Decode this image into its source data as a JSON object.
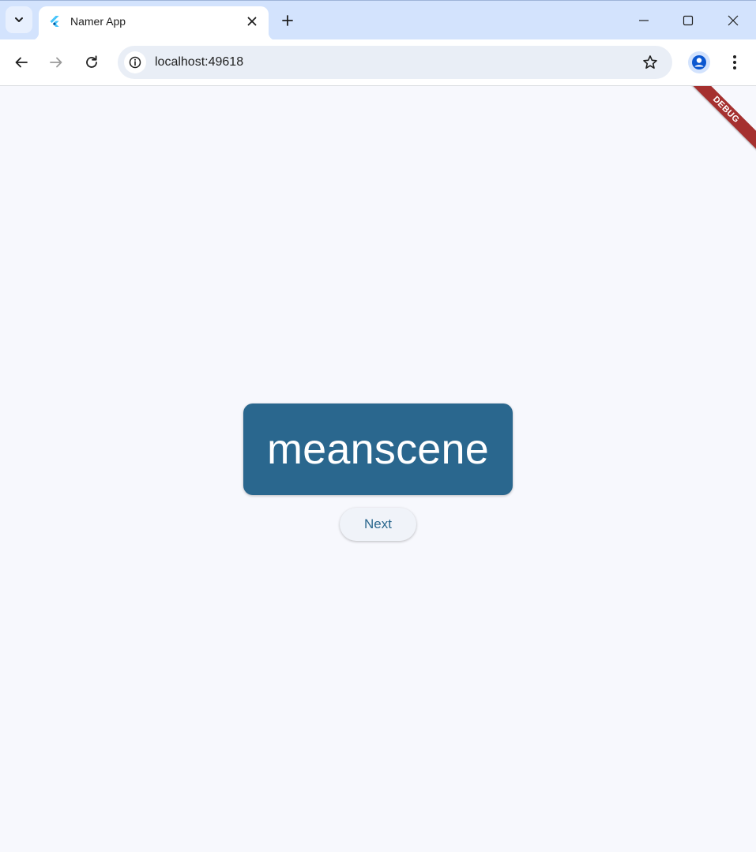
{
  "browser": {
    "tab": {
      "title": "Namer App",
      "favicon_icon": "flutter-icon"
    },
    "address_bar": {
      "url": "localhost:49618"
    },
    "colors": {
      "tabstrip": "#d3e3fd",
      "toolbar": "#ffffff",
      "omnibox": "#e9eef6"
    }
  },
  "app": {
    "word": "meanscene",
    "next_label": "Next",
    "debug_banner": "DEBUG",
    "colors": {
      "background": "#f7f8fd",
      "card": "#2a678e",
      "card_text": "#ffffff",
      "button_text": "#2a678e",
      "debug_banner": "#a5302f"
    }
  }
}
